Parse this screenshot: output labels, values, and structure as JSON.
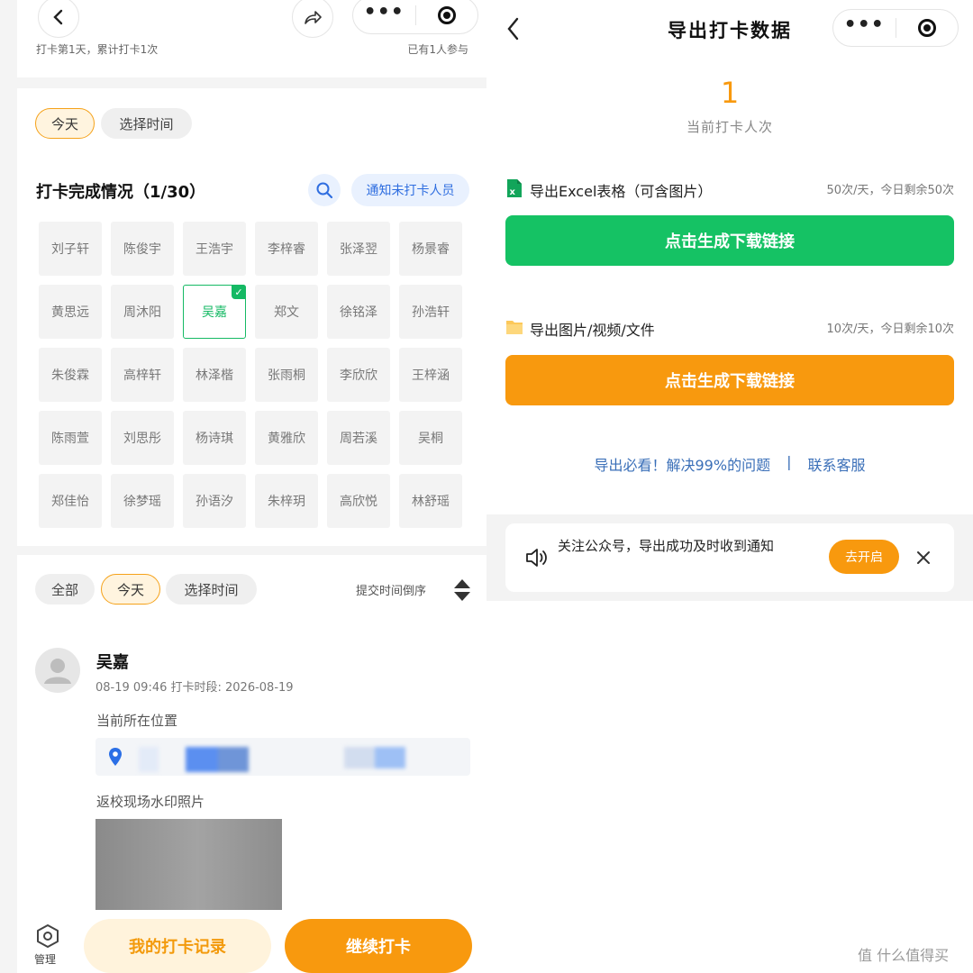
{
  "left": {
    "header_note_left": "打卡第1天，累计打卡1次",
    "header_note_right": "已有1人参与",
    "filter": [
      "今天",
      "选择时间"
    ],
    "completion_title": "打卡完成情况（1/30）",
    "notify_button": "通知未打卡人员",
    "names": [
      "刘子轩",
      "陈俊宇",
      "王浩宇",
      "李梓睿",
      "张泽翌",
      "杨景睿",
      "黄思远",
      "周沐阳",
      "吴嘉",
      "郑文",
      "徐铭泽",
      "孙浩轩",
      "朱俊霖",
      "高梓轩",
      "林泽楷",
      "张雨桐",
      "李欣欣",
      "王梓涵",
      "陈雨萱",
      "刘思彤",
      "杨诗琪",
      "黄雅欣",
      "周若溪",
      "吴桐",
      "郑佳怡",
      "徐梦瑶",
      "孙语汐",
      "朱梓玥",
      "高欣悦",
      "林舒瑶"
    ],
    "checked_name": "吴嘉",
    "record_tabs": [
      "全部",
      "今天",
      "选择时间"
    ],
    "sort_label": "提交时间倒序",
    "record": {
      "user": "吴嘉",
      "meta": "08-19 09:46 打卡时段: 2026-08-19",
      "location_label": "当前所在位置",
      "photo_label": "返校现场水印照片"
    },
    "manage_label": "管理",
    "my_records_button": "我的打卡记录",
    "continue_button": "继续打卡"
  },
  "right": {
    "title": "导出打卡数据",
    "count": "1",
    "count_label": "当前打卡人次",
    "excel_label": "导出Excel表格（可含图片）",
    "excel_quota": "50次/天，今日剩余50次",
    "excel_button": "点击生成下载链接",
    "media_label": "导出图片/视频/文件",
    "media_quota": "10次/天，今日剩余10次",
    "media_button": "点击生成下载链接",
    "help_link": "导出必看！解决99%的问题",
    "help_sep": "|",
    "contact_link": "联系客服",
    "notice_text": "关注公众号，导出成功及时收到通知",
    "notice_button": "去开启"
  },
  "watermark": "值 什么值得买",
  "colors": {
    "green": "#15c264",
    "orange": "#f8990e",
    "accent_text_blue": "#3a6fb8",
    "check_green": "#15b964"
  }
}
